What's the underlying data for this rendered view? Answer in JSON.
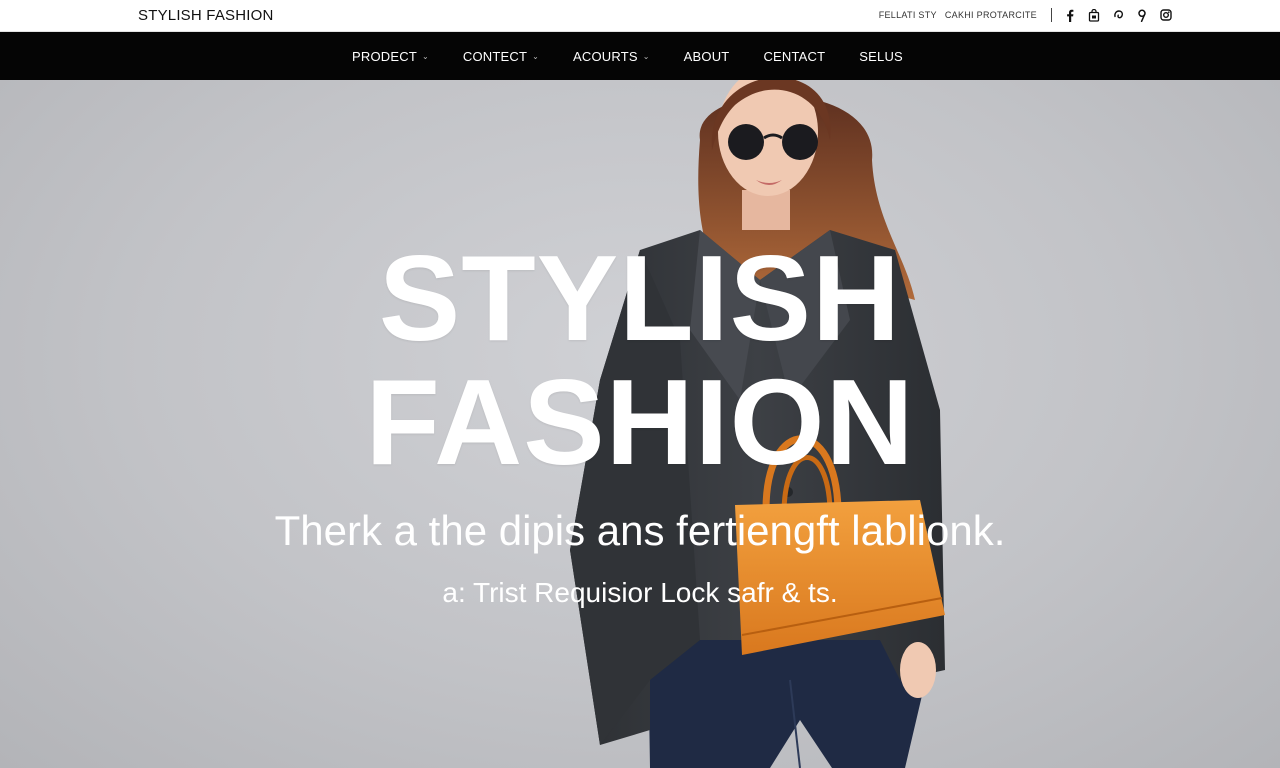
{
  "header": {
    "brand": "STYLISH FASHION",
    "utility_links": [
      "FELLATI STY",
      "CAKHI PROTARCITE"
    ],
    "social_icons": [
      "facebook-icon",
      "bag-icon",
      "pinterest-icon",
      "location-icon",
      "instagram-icon"
    ]
  },
  "nav": {
    "items": [
      {
        "label": "PRODECT",
        "has_dropdown": true
      },
      {
        "label": "CONTECT",
        "has_dropdown": true
      },
      {
        "label": "ACOURTS",
        "has_dropdown": true
      },
      {
        "label": "ABOUT",
        "has_dropdown": false
      },
      {
        "label": "CENTACT",
        "has_dropdown": false
      },
      {
        "label": "SELUS",
        "has_dropdown": false
      }
    ],
    "dropdown_glyph": "⌄"
  },
  "hero": {
    "title_line1": "STYLISH",
    "title_line2": "FASHION",
    "tagline": "Therk a the dipis ans fertiengft lablionk.",
    "subline": "a: Trist Requisior Lock safr & ts."
  },
  "colors": {
    "nav_bg": "#050505",
    "hero_bg": "#c3c4c8",
    "coat": "#35383c",
    "bag": "#e98a2c",
    "jeans": "#1f2a44",
    "hair": "#8c4a2a"
  }
}
